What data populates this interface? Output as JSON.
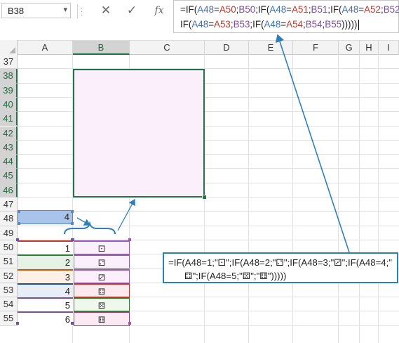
{
  "name_box": {
    "value": "B38"
  },
  "formula_bar": {
    "cancel_icon": "close-icon",
    "enter_icon": "check-icon",
    "fx_label": "fx",
    "line1": [
      {
        "t": "=IF(",
        "c": ""
      },
      {
        "t": "A48",
        "c": "blue"
      },
      {
        "t": "=",
        "c": ""
      },
      {
        "t": "A50",
        "c": "red"
      },
      {
        "t": ";",
        "c": ""
      },
      {
        "t": "B50",
        "c": "purple"
      },
      {
        "t": ";IF(",
        "c": ""
      },
      {
        "t": "A48",
        "c": "blue"
      },
      {
        "t": "=",
        "c": ""
      },
      {
        "t": "A51",
        "c": "red"
      },
      {
        "t": ";",
        "c": ""
      },
      {
        "t": "B51",
        "c": "purple"
      },
      {
        "t": ";IF(",
        "c": ""
      },
      {
        "t": "A48",
        "c": "blue"
      },
      {
        "t": "=",
        "c": ""
      },
      {
        "t": "A52",
        "c": "red"
      },
      {
        "t": ";",
        "c": ""
      },
      {
        "t": "B52",
        "c": "purple"
      },
      {
        "t": ";",
        "c": ""
      }
    ],
    "line2": [
      {
        "t": "IF(",
        "c": ""
      },
      {
        "t": "A48",
        "c": "blue"
      },
      {
        "t": "=",
        "c": ""
      },
      {
        "t": "A53",
        "c": "red"
      },
      {
        "t": ";",
        "c": ""
      },
      {
        "t": "B53",
        "c": "purple"
      },
      {
        "t": ";IF(",
        "c": ""
      },
      {
        "t": "A48",
        "c": "blue"
      },
      {
        "t": "=",
        "c": ""
      },
      {
        "t": "A54",
        "c": "red"
      },
      {
        "t": ";",
        "c": ""
      },
      {
        "t": "B54",
        "c": "purple"
      },
      {
        "t": ";",
        "c": ""
      },
      {
        "t": "B55",
        "c": "purple"
      },
      {
        "t": ")))))",
        "c": ""
      }
    ]
  },
  "columns": [
    "A",
    "B",
    "C",
    "D",
    "E",
    "F",
    "G",
    "H",
    "I"
  ],
  "selected_column": "B",
  "rows": [
    "37",
    "38",
    "39",
    "40",
    "41",
    "42",
    "43",
    "44",
    "45",
    "46",
    "47",
    "48",
    "49",
    "50",
    "51",
    "52",
    "53",
    "54",
    "55"
  ],
  "selected_rows": [
    "38",
    "39",
    "40",
    "41",
    "42",
    "43",
    "44",
    "45",
    "46"
  ],
  "cells": {
    "a48": "4",
    "a_values": [
      "1",
      "2",
      "3",
      "4",
      "5",
      "6"
    ],
    "b_values": [
      "⚀",
      "⚁",
      "⚂",
      "⚃",
      "⚄",
      "⚅"
    ]
  },
  "callout": {
    "line1": "=IF(A48=1;\"⚀\";IF(A48=2;\"⚁\";IF(A48=3;\"⚂\";IF(A48=4;\"",
    "line2": "⚃\";IF(A48=5;\"⚄\";\"⚅\")))))"
  },
  "colors": {
    "selection_green": "#217346",
    "ref_blue": "#3d6fb6",
    "callout_border": "#2e7fb8",
    "merged_fill": "#fbeffb",
    "a48_fill": "#a9c4eb"
  }
}
